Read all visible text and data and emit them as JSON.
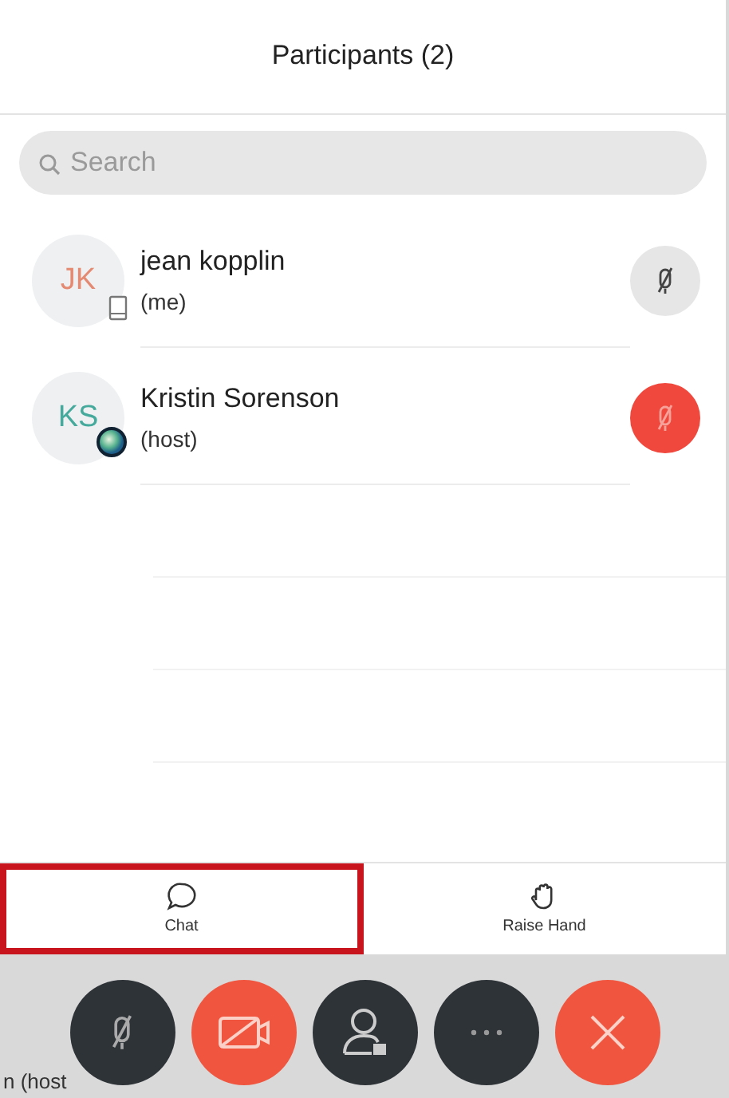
{
  "panel": {
    "title": "Participants (2)"
  },
  "search": {
    "placeholder": "Search"
  },
  "participants": [
    {
      "initials": "JK",
      "color": "#e58a72",
      "name": "jean kopplin",
      "role": "(me)",
      "badge": {
        "kind": "phone"
      },
      "mic": {
        "muted": true,
        "color": "#e6e6e6"
      }
    },
    {
      "initials": "KS",
      "color": "#45a99c",
      "name": "Kristin Sorenson",
      "role": "(host)",
      "badge": {
        "kind": "web"
      },
      "mic": {
        "muted": true,
        "color": "#f0483d"
      }
    }
  ],
  "actions": [
    {
      "kind": "chat",
      "label": "Chat",
      "highlighted": true
    },
    {
      "kind": "raise-hand",
      "label": "Raise Hand",
      "highlighted": false
    }
  ],
  "controls": [
    {
      "kind": "mute",
      "color": "#2e3338"
    },
    {
      "kind": "video",
      "color": "#f0563f"
    },
    {
      "kind": "participants",
      "color": "#2e3338"
    },
    {
      "kind": "more",
      "color": "#2e3338"
    },
    {
      "kind": "leave",
      "color": "#f0563f"
    }
  ],
  "background_caption": "n (host"
}
